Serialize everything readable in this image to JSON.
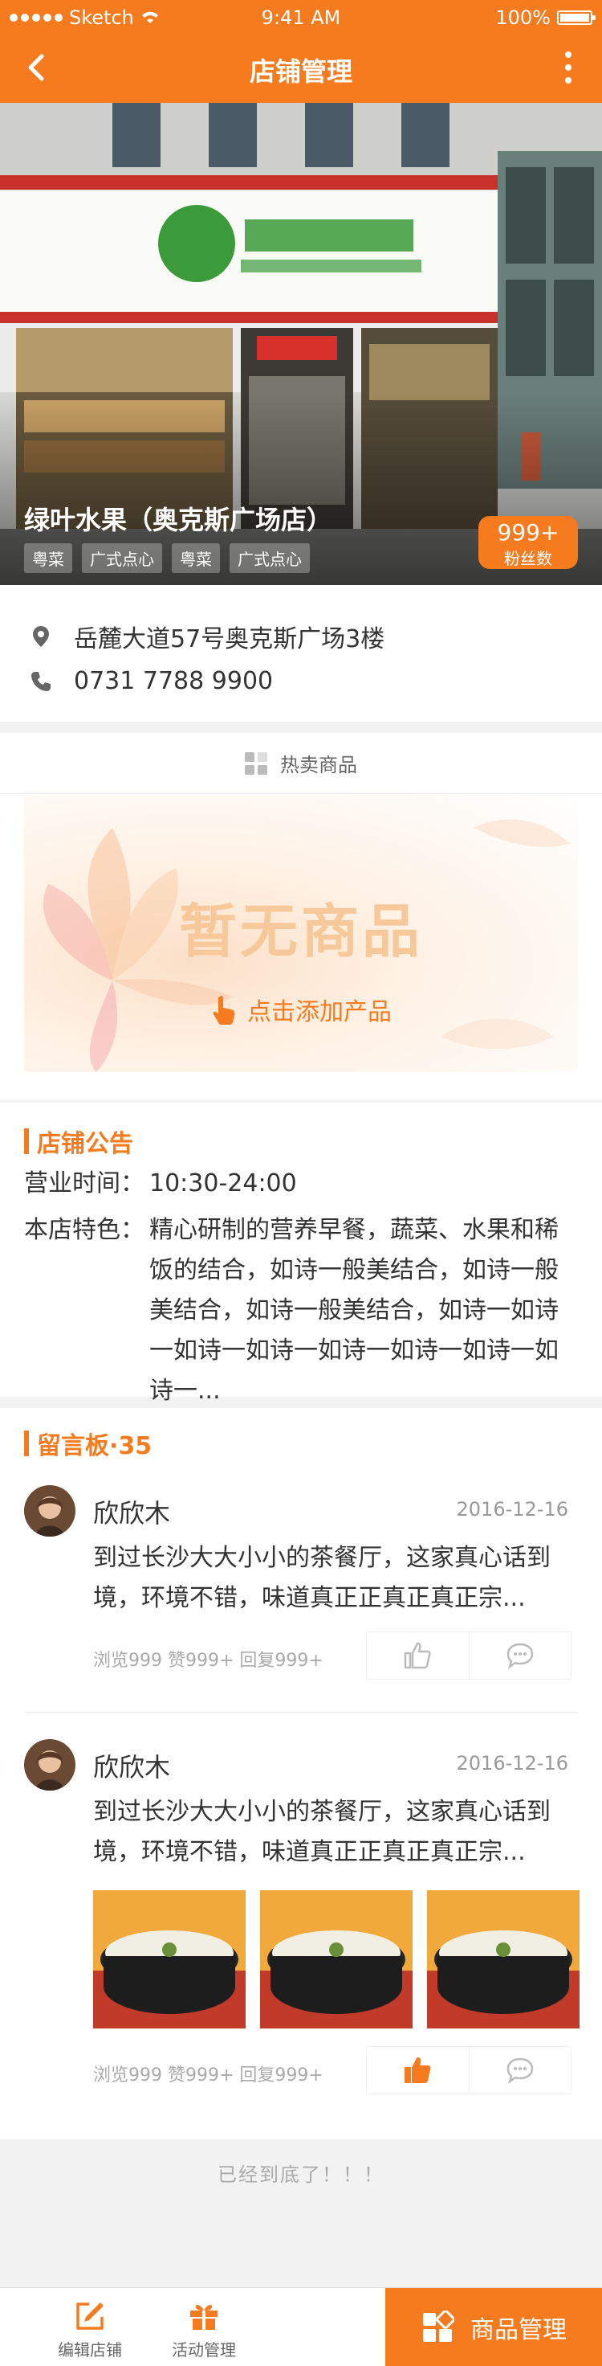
{
  "status_bar": {
    "carrier": "Sketch",
    "time": "9:41 AM",
    "battery": "100%",
    "battery_level": 1.0
  },
  "header": {
    "title": "店铺管理",
    "back_icon": "chevron-left-icon",
    "more_icon": "more-vertical-icon"
  },
  "hero": {
    "store_name": "绿叶水果（奥克斯广场店）",
    "tags": [
      "粤菜",
      "广式点心",
      "粤菜",
      "广式点心"
    ],
    "fans_count": "999+",
    "fans_label": "粉丝数"
  },
  "info": {
    "address": "岳麓大道57号奥克斯广场3楼",
    "phone": "0731 7788 9900",
    "address_icon": "location-pin-icon",
    "phone_icon": "phone-icon"
  },
  "hot": {
    "title": "热卖商品",
    "empty_text": "暂无商品",
    "add_label": "点击添加产品"
  },
  "notice": {
    "title": "店铺公告",
    "hours_key": "营业时间：",
    "hours_value": "10:30-24:00",
    "feature_key": "本店特色：",
    "feature_value": "精心研制的营养早餐，蔬菜、水果和稀饭的结合，如诗一般美结合，如诗一般美结合，如诗一般美结合，如诗一如诗一如诗一如诗一如诗一如诗一如诗一如诗一..."
  },
  "board": {
    "title": "留言板·35",
    "comments": [
      {
        "name": "欣欣木",
        "date": "2016-12-16",
        "text": "到过长沙大大小小的茶餐厅，这家真心话到境，环境不错，味道真正正真正真正宗...",
        "meta": "浏览999 赞999+ 回复999+",
        "liked": false
      },
      {
        "name": "欣欣木",
        "date": "2016-12-16",
        "text": "到过长沙大大小小的茶餐厅，这家真心话到境，环境不错，味道真正正真正真正宗...",
        "meta": "浏览999 赞999+ 回复999+",
        "liked": true
      }
    ]
  },
  "end_text": "已经到底了！！！",
  "bottom_bar": {
    "edit_label": "编辑店铺",
    "activity_label": "活动管理",
    "goods_label": "商品管理"
  },
  "colors": {
    "accent": "#f57b1e"
  }
}
